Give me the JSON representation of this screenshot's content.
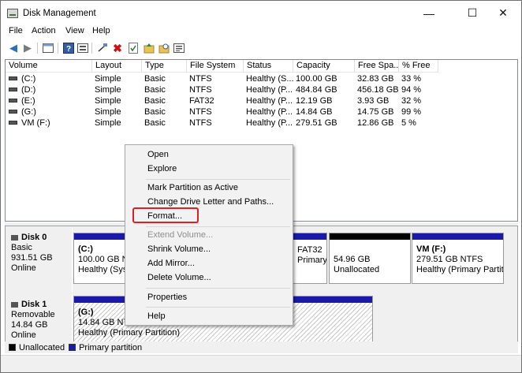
{
  "window": {
    "title": "Disk Management",
    "controls": {
      "minimize": "—",
      "maximize": "☐",
      "close": "✕"
    }
  },
  "menubar": [
    "File",
    "Action",
    "View",
    "Help"
  ],
  "toolbar_icons": [
    "back-arrow-icon",
    "forward-arrow-icon",
    "properties-icon",
    "help-icon",
    "refresh-icon",
    "delete-icon",
    "check-icon",
    "up-folder-icon",
    "search-folder-icon",
    "list-icon"
  ],
  "volume_list": {
    "headers": [
      "Volume",
      "Layout",
      "Type",
      "File System",
      "Status",
      "Capacity",
      "Free Spa...",
      "% Free"
    ],
    "rows": [
      [
        "(C:)",
        "Simple",
        "Basic",
        "NTFS",
        "Healthy (S...",
        "100.00 GB",
        "32.83 GB",
        "33 %"
      ],
      [
        "(D:)",
        "Simple",
        "Basic",
        "NTFS",
        "Healthy (P...",
        "484.84 GB",
        "456.18 GB",
        "94 %"
      ],
      [
        "(E:)",
        "Simple",
        "Basic",
        "FAT32",
        "Healthy (P...",
        "12.19 GB",
        "3.93 GB",
        "32 %"
      ],
      [
        "(G:)",
        "Simple",
        "Basic",
        "NTFS",
        "Healthy (P...",
        "14.84 GB",
        "14.75 GB",
        "99 %"
      ],
      [
        "VM (F:)",
        "Simple",
        "Basic",
        "NTFS",
        "Healthy (P...",
        "279.51 GB",
        "12.86 GB",
        "5 %"
      ]
    ]
  },
  "disks": [
    {
      "name": "Disk 0",
      "type": "Basic",
      "size": "931.51 GB",
      "status": "Online",
      "partitions": [
        {
          "label": "(C:)",
          "size": "100.00 GB NTFS",
          "status": "Healthy (System, Boot, Page File, Active, Crash Dump, Primary Partition)"
        },
        {
          "label": "",
          "size": "FAT32",
          "status": "Primary"
        },
        {
          "label": "",
          "size": "54.96 GB",
          "status": "Unallocated"
        },
        {
          "label": "VM  (F:)",
          "size": "279.51 GB NTFS",
          "status": "Healthy (Primary Partition)"
        }
      ]
    },
    {
      "name": "Disk 1",
      "type": "Removable",
      "size": "14.84 GB",
      "status": "Online",
      "partitions": [
        {
          "label": "(G:)",
          "size": "14.84 GB NTFS",
          "status": "Healthy (Primary Partition)"
        }
      ]
    }
  ],
  "legend": [
    {
      "label": "Unallocated",
      "color": "#000000"
    },
    {
      "label": "Primary partition",
      "color": "#1a1aa8"
    }
  ],
  "context_menu": {
    "items": [
      "Open",
      "Explore",
      "Mark Partition as Active",
      "Change Drive Letter and Paths...",
      "Format...",
      "Extend Volume...",
      "Shrink Volume...",
      "Add Mirror...",
      "Delete Volume...",
      "Properties",
      "Help"
    ],
    "disabled": [
      "Extend Volume..."
    ],
    "highlighted": "Format..."
  },
  "colors": {
    "primary_partition": "#1a1aa8",
    "unallocated": "#000000",
    "highlight_outline": "#e02020"
  }
}
